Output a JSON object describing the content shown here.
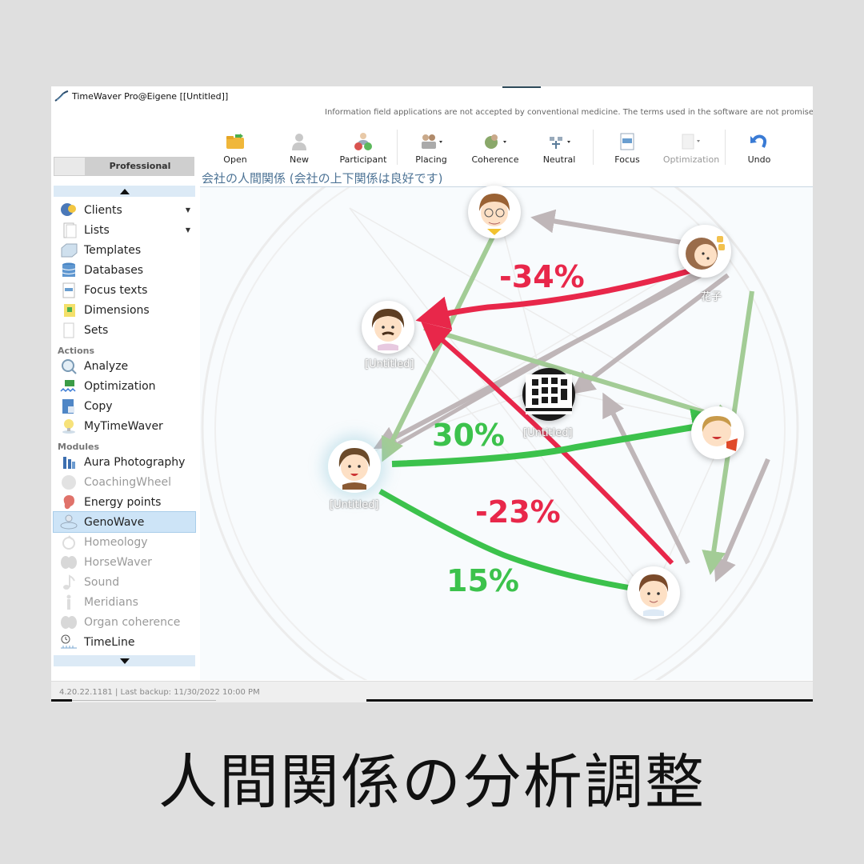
{
  "window": {
    "title": "TimeWaver Pro@Eigene [[Untitled]]",
    "disclaimer": "Information field applications are not accepted by conventional medicine. The terms used in the software are not promises of c"
  },
  "toolbar": {
    "items": [
      {
        "label": "Open",
        "icon": "folder-open-icon",
        "enabled": true
      },
      {
        "label": "New",
        "icon": "person-icon",
        "enabled": true
      },
      {
        "label": "Participant",
        "icon": "participant-icon",
        "enabled": true
      },
      {
        "label": "Placing",
        "icon": "placing-icon",
        "enabled": true,
        "dropdown": true
      },
      {
        "label": "Coherence",
        "icon": "coherence-icon",
        "enabled": true,
        "dropdown": true
      },
      {
        "label": "Neutral",
        "icon": "neutral-icon",
        "enabled": true,
        "dropdown": true
      },
      {
        "label": "Focus",
        "icon": "focus-icon",
        "enabled": true
      },
      {
        "label": "Optimization",
        "icon": "optimization-icon",
        "enabled": false,
        "dropdown": true
      },
      {
        "label": "Undo",
        "icon": "undo-icon",
        "enabled": true
      }
    ]
  },
  "sidebar": {
    "mode_label": "Professional",
    "items": [
      {
        "label": "Clients",
        "icon": "clients-icon",
        "dropdown": true
      },
      {
        "label": "Lists",
        "icon": "lists-icon",
        "dropdown": true
      },
      {
        "label": "Templates",
        "icon": "templates-icon"
      },
      {
        "label": "Databases",
        "icon": "database-icon"
      },
      {
        "label": "Focus texts",
        "icon": "focus-texts-icon"
      },
      {
        "label": "Dimensions",
        "icon": "dimensions-icon"
      },
      {
        "label": "Sets",
        "icon": "sets-icon"
      }
    ],
    "actions_header": "Actions",
    "actions": [
      {
        "label": "Analyze",
        "icon": "analyze-icon"
      },
      {
        "label": "Optimization",
        "icon": "optimization-icon"
      },
      {
        "label": "Copy",
        "icon": "copy-icon"
      },
      {
        "label": "MyTimeWaver",
        "icon": "lightbulb-icon"
      }
    ],
    "modules_header": "Modules",
    "modules": [
      {
        "label": "Aura Photography",
        "icon": "aura-icon",
        "enabled": true
      },
      {
        "label": "CoachingWheel",
        "icon": "coaching-wheel-icon",
        "enabled": false
      },
      {
        "label": "Energy points",
        "icon": "ear-icon",
        "enabled": true
      },
      {
        "label": "GenoWave",
        "icon": "genowave-icon",
        "enabled": true,
        "selected": true
      },
      {
        "label": "Homeology",
        "icon": "homeology-icon",
        "enabled": false
      },
      {
        "label": "HorseWaver",
        "icon": "horsewaver-icon",
        "enabled": false
      },
      {
        "label": "Sound",
        "icon": "music-note-icon",
        "enabled": false
      },
      {
        "label": "Meridians",
        "icon": "meridians-icon",
        "enabled": false
      },
      {
        "label": "Organ coherence",
        "icon": "organ-icon",
        "enabled": false
      },
      {
        "label": "TimeLine",
        "icon": "clock-icon",
        "enabled": true
      }
    ]
  },
  "canvas": {
    "title": "会社の人間関係 (会社の上下関係は良好です)",
    "nodes": [
      {
        "id": "top",
        "label": "",
        "avatar": "man-glasses"
      },
      {
        "id": "hanako",
        "label": "花子",
        "avatar": "woman"
      },
      {
        "id": "left-upper",
        "label": "[Untitled]",
        "avatar": "man-mustache"
      },
      {
        "id": "center",
        "label": "[Untitled]",
        "avatar": "company-building"
      },
      {
        "id": "right",
        "label": "",
        "avatar": "child-scarf"
      },
      {
        "id": "left",
        "label": "[Untitled]",
        "avatar": "young-man"
      },
      {
        "id": "bottom",
        "label": "",
        "avatar": "boy"
      }
    ],
    "relations": [
      {
        "from": "hanako",
        "to": "left-upper",
        "value": "-34%",
        "color": "#e8274a"
      },
      {
        "from": "left",
        "to": "right",
        "value": "30%",
        "color": "#3cc24c"
      },
      {
        "from": "bottom",
        "to": "left-upper",
        "value": "-23%",
        "color": "#e8274a"
      },
      {
        "from": "left",
        "to": "bottom",
        "value": "15%",
        "color": "#3cc24c"
      }
    ]
  },
  "status": {
    "text": "4.20.22.1181  |  Last backup: 11/30/2022 10:00 PM"
  },
  "caption": "人間関係の分析調整"
}
